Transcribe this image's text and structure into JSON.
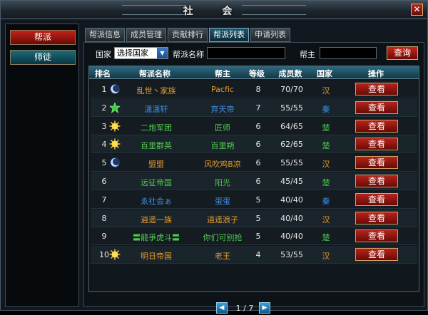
{
  "window": {
    "title": "社 会",
    "close_glyph": "✕"
  },
  "side": {
    "items": [
      {
        "label": "帮派",
        "active": true
      },
      {
        "label": "师徒",
        "active": false
      }
    ]
  },
  "tabs": [
    {
      "label": "帮派信息",
      "active": false
    },
    {
      "label": "成员管理",
      "active": false
    },
    {
      "label": "贡献排行",
      "active": false
    },
    {
      "label": "帮派列表",
      "active": true
    },
    {
      "label": "申请列表",
      "active": false
    }
  ],
  "search": {
    "country_label": "国家",
    "country_value": "选择国家",
    "gang_name_label": "帮派名称",
    "leader_label": "帮主",
    "query_label": "查询"
  },
  "table": {
    "headers": [
      "排名",
      "帮派名称",
      "帮主",
      "等级",
      "成员数",
      "国家",
      "操作"
    ],
    "action_label": "查看",
    "rows": [
      {
        "rank": "1",
        "icon": "moon-icon",
        "name": "乱世丶家族",
        "name_color": "#e39a2a",
        "leader": "Pacfic",
        "leader_color": "#e39a2a",
        "level": "8",
        "members": "70/70",
        "country": "汉",
        "country_color": "#e39a2a"
      },
      {
        "rank": "2",
        "icon": "star-icon",
        "name": "潇潇轩",
        "name_color": "#3b8fe8",
        "leader": "弃天帝",
        "leader_color": "#3b8fe8",
        "level": "7",
        "members": "55/55",
        "country": "秦",
        "country_color": "#3b8fe8"
      },
      {
        "rank": "3",
        "icon": "sun-icon",
        "name": "二炮军团",
        "name_color": "#4ec94e",
        "leader": "匠师",
        "leader_color": "#4ec94e",
        "level": "6",
        "members": "64/65",
        "country": "楚",
        "country_color": "#4ec94e"
      },
      {
        "rank": "4",
        "icon": "sun-icon",
        "name": "百里群英",
        "name_color": "#4ec94e",
        "leader": "百里朔",
        "leader_color": "#4ec94e",
        "level": "6",
        "members": "62/65",
        "country": "楚",
        "country_color": "#4ec94e"
      },
      {
        "rank": "5",
        "icon": "moon-icon",
        "name": "盟盟",
        "name_color": "#e39a2a",
        "leader": "风吹鸡B凉",
        "leader_color": "#e39a2a",
        "level": "6",
        "members": "55/55",
        "country": "汉",
        "country_color": "#e39a2a"
      },
      {
        "rank": "6",
        "icon": "",
        "name": "远征帝国",
        "name_color": "#4ec94e",
        "leader": "阳光",
        "leader_color": "#4ec94e",
        "level": "6",
        "members": "45/45",
        "country": "楚",
        "country_color": "#4ec94e"
      },
      {
        "rank": "7",
        "icon": "",
        "name": "ゑ社会ぁ",
        "name_color": "#3b8fe8",
        "leader": "蛋蛋",
        "leader_color": "#3b8fe8",
        "level": "5",
        "members": "40/40",
        "country": "秦",
        "country_color": "#3b8fe8"
      },
      {
        "rank": "8",
        "icon": "",
        "name": "逍遥一族",
        "name_color": "#e39a2a",
        "leader": "逍遥浪子",
        "leader_color": "#e39a2a",
        "level": "5",
        "members": "40/40",
        "country": "汉",
        "country_color": "#e39a2a"
      },
      {
        "rank": "9",
        "icon": "",
        "name": "〓龍爭虎斗〓",
        "name_color": "#4ec94e",
        "leader": "你们可别抢",
        "leader_color": "#4ec94e",
        "level": "5",
        "members": "40/40",
        "country": "楚",
        "country_color": "#4ec94e"
      },
      {
        "rank": "10",
        "icon": "sun-icon",
        "name": "明日帝国",
        "name_color": "#e39a2a",
        "leader": "老王",
        "leader_color": "#e39a2a",
        "level": "4",
        "members": "53/55",
        "country": "汉",
        "country_color": "#e39a2a"
      }
    ]
  },
  "pager": {
    "prev_glyph": "◀",
    "next_glyph": "▶",
    "text": "1 / 7"
  }
}
